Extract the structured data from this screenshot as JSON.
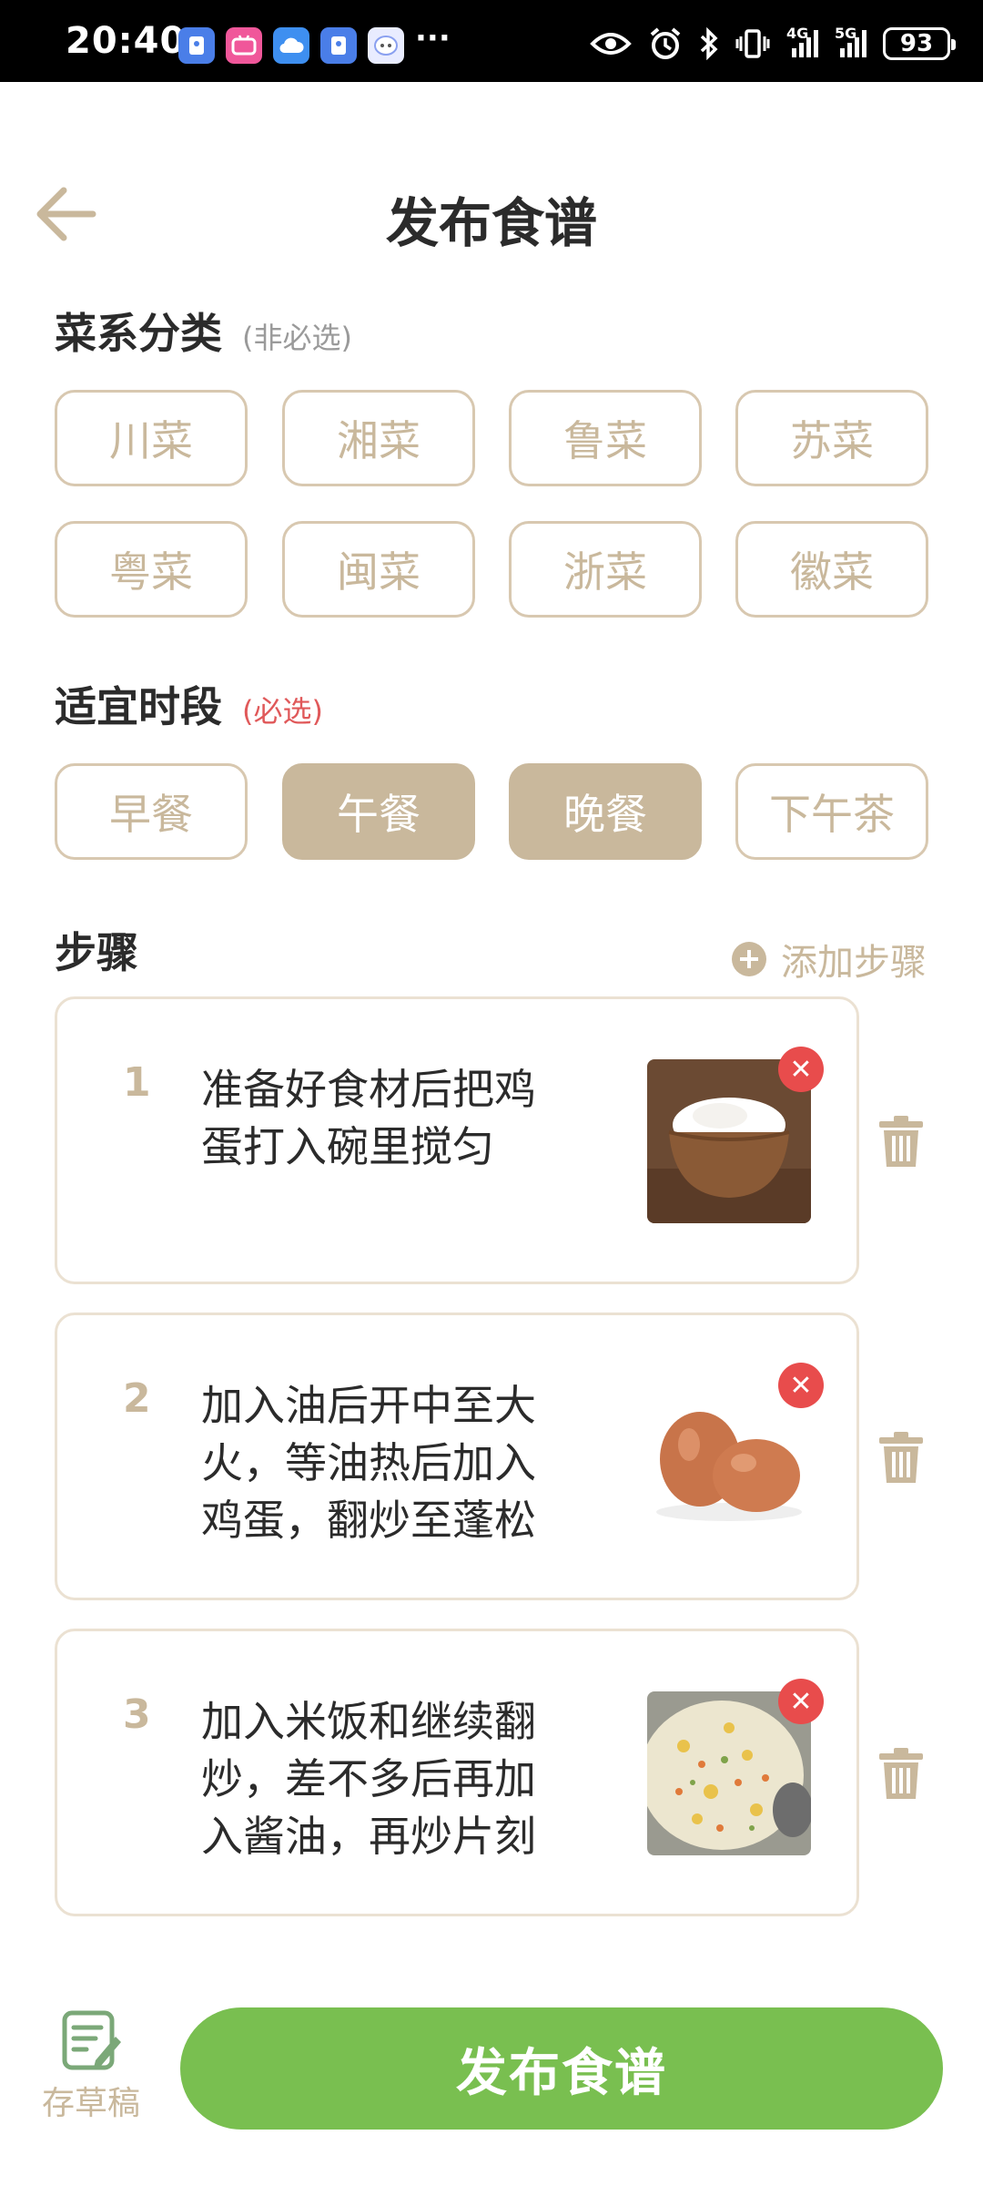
{
  "status_bar": {
    "time": "20:40",
    "app_icons": [
      "pin-app-icon",
      "bilibili-icon",
      "cloud-icon",
      "pin-app-icon",
      "chat-bot-icon"
    ],
    "more": "···",
    "net1": "4G",
    "net2": "5G",
    "battery": "93"
  },
  "header": {
    "title": "发布食谱"
  },
  "cuisine": {
    "title": "菜系分类",
    "note": "(非必选)",
    "options": [
      "川菜",
      "湘菜",
      "鲁菜",
      "苏菜",
      "粤菜",
      "闽菜",
      "浙菜",
      "徽菜"
    ]
  },
  "mealtime": {
    "title": "适宜时段",
    "note": "(必选)",
    "options": [
      "早餐",
      "午餐",
      "晚餐",
      "下午茶"
    ],
    "selected": [
      "午餐",
      "晚餐"
    ]
  },
  "steps": {
    "title": "步骤",
    "add_label": "添加步骤",
    "items": [
      {
        "num": "1",
        "text": "准备好食材后把鸡蛋打入碗里搅匀",
        "image": "bowl-of-rice"
      },
      {
        "num": "2",
        "text": "加入油后开中至大火，等油热后加入鸡蛋，翻炒至蓬松",
        "image": "brown-eggs"
      },
      {
        "num": "3",
        "text": "加入米饭和继续翻炒，差不多后再加入酱油，再炒片刻",
        "image": "fried-rice"
      }
    ]
  },
  "footer": {
    "draft_label": "存草稿",
    "publish_label": "发布食谱"
  },
  "colors": {
    "accent": "#c9b89c",
    "publish": "#79bf50",
    "delete": "#e84c4c",
    "required": "#e0595a"
  }
}
